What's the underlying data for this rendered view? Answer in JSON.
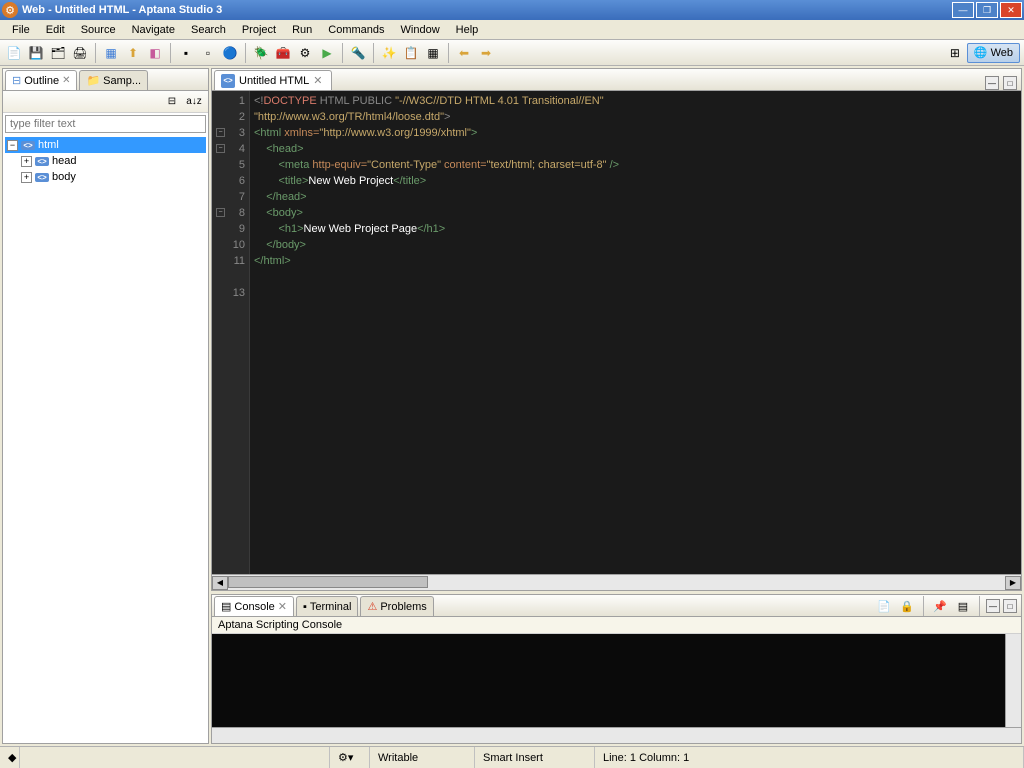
{
  "window": {
    "title": "Web - Untitled HTML - Aptana Studio 3"
  },
  "menu": [
    "File",
    "Edit",
    "Source",
    "Navigate",
    "Search",
    "Project",
    "Run",
    "Commands",
    "Window",
    "Help"
  ],
  "perspective": {
    "label": "Web"
  },
  "left": {
    "tabs": {
      "outline": "Outline",
      "samples": "Samp..."
    },
    "filter_placeholder": "type filter text",
    "tree": {
      "root": "html",
      "head": "head",
      "body": "body"
    }
  },
  "editor": {
    "tab_label": "Untitled HTML",
    "lines": [
      "1",
      "2",
      "3",
      "4",
      "5",
      "6",
      "7",
      "8",
      "9",
      "10",
      "11",
      "",
      "13"
    ],
    "code": {
      "l1": {
        "a": "<!",
        "b": "DOCTYPE",
        "c": " HTML PUBLIC ",
        "d": "\"-//W3C//DTD HTML 4.01 Transitional//EN\""
      },
      "l2": {
        "a": "\"http://www.w3.org/TR/html4/loose.dtd\"",
        "b": ">"
      },
      "l3": {
        "a": "<html ",
        "b": "xmlns=",
        "c": "\"http://www.w3.org/1999/xhtml\"",
        "d": ">"
      },
      "l4": "    <head>",
      "l5": {
        "a": "        <meta ",
        "b": "http-equiv=",
        "c": "\"Content-Type\"",
        "d": " content=",
        "e": "\"text/html; charset=utf-8\"",
        "f": " />"
      },
      "l6": {
        "a": "        <title>",
        "b": "New Web Project",
        "c": "</title>"
      },
      "l7": "    </head>",
      "l8": "    <body>",
      "l9": {
        "a": "        <h1>",
        "b": "New Web Project Page",
        "c": "</h1>"
      },
      "l10": "    </body>",
      "l11": "</html>"
    }
  },
  "bottom": {
    "tabs": {
      "console": "Console",
      "terminal": "Terminal",
      "problems": "Problems"
    },
    "console_title": "Aptana Scripting Console"
  },
  "status": {
    "writable": "Writable",
    "insert": "Smart Insert",
    "pos": "Line: 1 Column: 1"
  }
}
